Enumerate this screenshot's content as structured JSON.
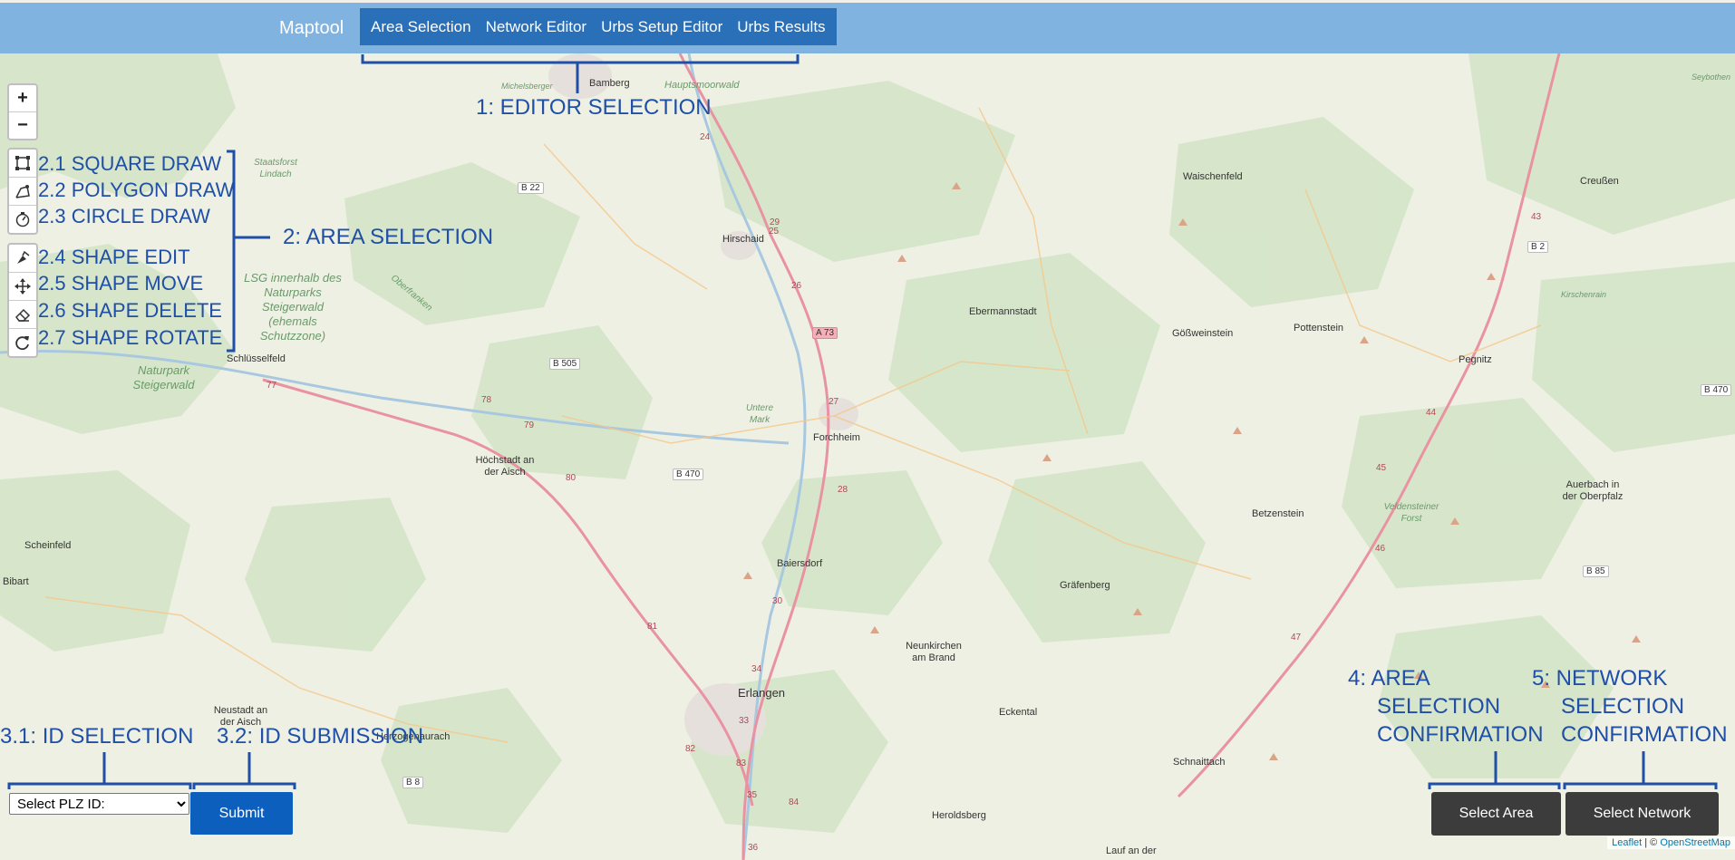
{
  "navbar": {
    "brand": "Maptool",
    "tabs": [
      {
        "label": "Area Selection"
      },
      {
        "label": "Network Editor"
      },
      {
        "label": "Urbs Setup Editor"
      },
      {
        "label": "Urbs Results"
      }
    ],
    "background": "#80b3df",
    "active_tab_background": "#2a70b8"
  },
  "map": {
    "zoom_in_label": "+",
    "zoom_out_label": "−",
    "places": [
      {
        "name": "Bamberg",
        "style": "normal"
      },
      {
        "name": "Hauptsmoorwald",
        "style": "italic"
      },
      {
        "name": "Michelsberger",
        "style": "italic"
      },
      {
        "name": "Staatsforst Lindach",
        "style": "italic"
      },
      {
        "name": "Waischenfeld",
        "style": "normal"
      },
      {
        "name": "Creußen",
        "style": "normal"
      },
      {
        "name": "Hirschaid",
        "style": "normal"
      },
      {
        "name": "Ebermannstadt",
        "style": "normal"
      },
      {
        "name": "Gößweinstein",
        "style": "normal"
      },
      {
        "name": "Pottenstein",
        "style": "normal"
      },
      {
        "name": "Pegnitz",
        "style": "normal"
      },
      {
        "name": "Kirschenrain",
        "style": "italic"
      },
      {
        "name": "LSG innerhalb des Naturparks Steigerwald (ehemals Schutzzone)",
        "style": "italic"
      },
      {
        "name": "Oberfranken",
        "style": "italic"
      },
      {
        "name": "Naturpark Steigerwald",
        "style": "italic"
      },
      {
        "name": "Schlüsselfeld",
        "style": "normal"
      },
      {
        "name": "Untere Mark",
        "style": "italic"
      },
      {
        "name": "Forchheim",
        "style": "normal"
      },
      {
        "name": "Höchstadt an der Aisch",
        "style": "normal"
      },
      {
        "name": "Veldensteiner Forst",
        "style": "italic"
      },
      {
        "name": "Auerbach in der Oberpfalz",
        "style": "normal"
      },
      {
        "name": "Betzenstein",
        "style": "normal"
      },
      {
        "name": "Scheinfeld",
        "style": "normal"
      },
      {
        "name": "Baiersdorf",
        "style": "normal"
      },
      {
        "name": "Gräfenberg",
        "style": "normal"
      },
      {
        "name": "Bibart",
        "style": "normal"
      },
      {
        "name": "Neunkirchen am Brand",
        "style": "normal"
      },
      {
        "name": "Neustadt an der Aisch",
        "style": "normal"
      },
      {
        "name": "Erlangen",
        "style": "normal"
      },
      {
        "name": "Eckental",
        "style": "normal"
      },
      {
        "name": "Herzogenaurach",
        "style": "normal"
      },
      {
        "name": "Schnaittach",
        "style": "normal"
      },
      {
        "name": "Heroldsberg",
        "style": "normal"
      },
      {
        "name": "Lauf an der",
        "style": "normal"
      },
      {
        "name": "Seybothen",
        "style": "italic"
      }
    ],
    "road_shields": [
      "B 22",
      "A 73",
      "B 505",
      "B 470",
      "B 2",
      "B 470",
      "B 85",
      "B 8"
    ],
    "road_numbers": [
      "24",
      "25",
      "26",
      "27",
      "28",
      "29",
      "30",
      "77",
      "78",
      "79",
      "80",
      "81",
      "82",
      "83",
      "84",
      "33",
      "34",
      "35",
      "36",
      "43",
      "44",
      "45",
      "46",
      "47"
    ]
  },
  "annotations": {
    "editor_selection": "1: EDITOR SELECTION",
    "draw_tools": [
      {
        "label": "2.1 SQUARE DRAW",
        "icon": "square-draw-icon"
      },
      {
        "label": "2.2 POLYGON DRAW",
        "icon": "polygon-draw-icon"
      },
      {
        "label": "2.3 CIRCLE DRAW",
        "icon": "circle-draw-icon"
      }
    ],
    "edit_tools": [
      {
        "label": "2.4 SHAPE EDIT",
        "icon": "shape-edit-icon"
      },
      {
        "label": "2.5 SHAPE MOVE",
        "icon": "shape-move-icon"
      },
      {
        "label": "2.6 SHAPE DELETE",
        "icon": "eraser-icon"
      },
      {
        "label": "2.7 SHAPE ROTATE",
        "icon": "rotate-icon"
      }
    ],
    "area_selection": "2: AREA SELECTION",
    "id_selection": "3.1: ID SELECTION",
    "id_submission": "3.2: ID SUBMISSION",
    "area_confirm": [
      "4: AREA",
      "SELECTION",
      "CONFIRMATION"
    ],
    "network_confirm": [
      "5: NETWORK",
      "SELECTION",
      "CONFIRMATION"
    ],
    "color": "#1f4fa6"
  },
  "controls": {
    "plz_select_value": "Select PLZ ID:",
    "submit_label": "Submit",
    "select_area_label": "Select Area",
    "select_network_label": "Select Network"
  },
  "attribution": {
    "leaflet": "Leaflet",
    "separator": " | © ",
    "osm": "OpenStreetMap"
  }
}
